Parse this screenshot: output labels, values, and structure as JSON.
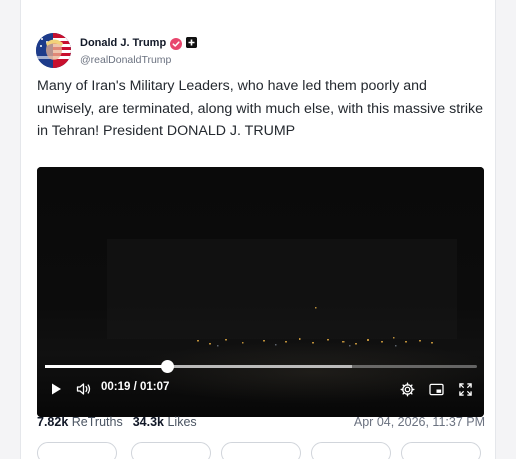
{
  "post": {
    "author_name": "Donald J. Trump",
    "author_handle": "@realDonaldTrump",
    "text": "Many of Iran's Military Leaders, who have led them poorly and unwisely, are terminated, along with much else, with this massive strike in Tehran! President DONALD J. TRUMP"
  },
  "video": {
    "time_display": "00:19 / 01:07",
    "progress": 0.283,
    "buffered": 0.71
  },
  "stats": {
    "retruths_count": "7.82k",
    "retruths_label": "ReTruths",
    "likes_count": "34.3k",
    "likes_label": "Likes",
    "timestamp": "Apr 04, 2026, 11:37 PM"
  },
  "icons": {
    "verified": "verified-badge-icon",
    "platform": "plus-square-icon",
    "play": "play-icon",
    "volume": "volume-icon",
    "settings": "gear-icon",
    "pip": "picture-in-picture-icon",
    "fullscreen": "fullscreen-icon"
  },
  "colors": {
    "verified_badge": "#e8466d",
    "card_background": "#ffffff",
    "video_background": "#050505"
  }
}
